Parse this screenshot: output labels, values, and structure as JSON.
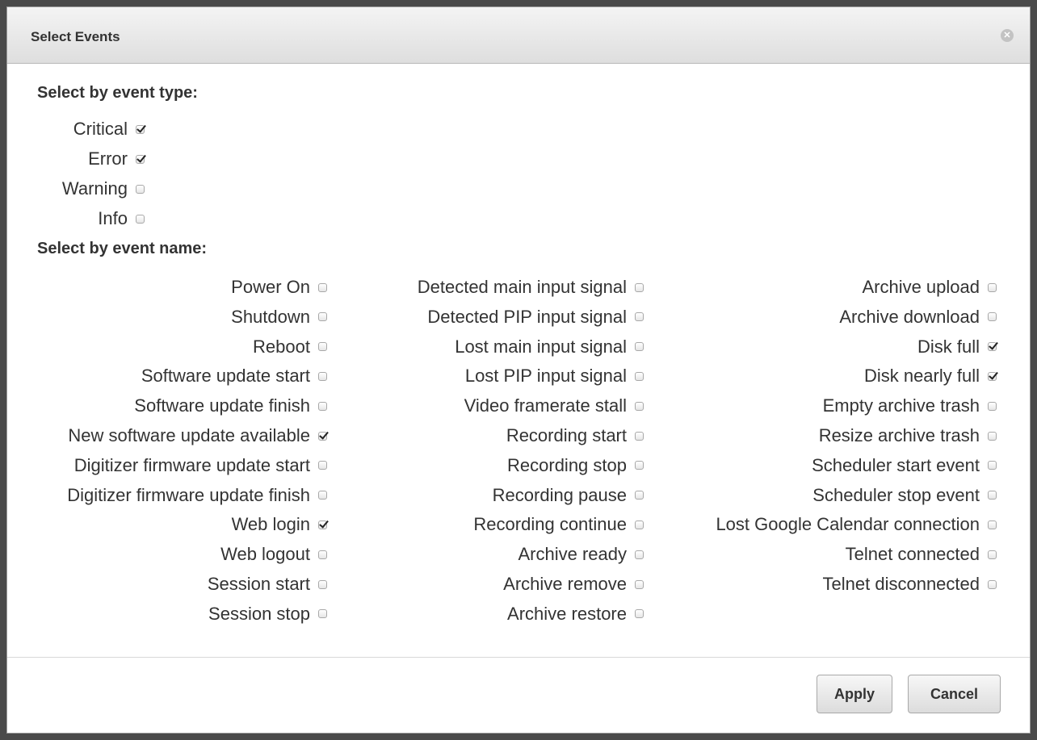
{
  "dialog": {
    "title": "Select Events",
    "close_icon": "close-circle-icon"
  },
  "type_section": {
    "heading": "Select by event type:",
    "items": [
      {
        "label": "Critical",
        "checked": true
      },
      {
        "label": "Error",
        "checked": true
      },
      {
        "label": "Warning",
        "checked": false
      },
      {
        "label": "Info",
        "checked": false
      }
    ]
  },
  "name_section": {
    "heading": "Select by event name:",
    "columns": [
      [
        {
          "label": "Power On",
          "checked": false
        },
        {
          "label": "Shutdown",
          "checked": false
        },
        {
          "label": "Reboot",
          "checked": false
        },
        {
          "label": "Software update start",
          "checked": false
        },
        {
          "label": "Software update finish",
          "checked": false
        },
        {
          "label": "New software update available",
          "checked": true
        },
        {
          "label": "Digitizer firmware update start",
          "checked": false
        },
        {
          "label": "Digitizer firmware update finish",
          "checked": false
        },
        {
          "label": "Web login",
          "checked": true
        },
        {
          "label": "Web logout",
          "checked": false
        },
        {
          "label": "Session start",
          "checked": false
        },
        {
          "label": "Session stop",
          "checked": false
        }
      ],
      [
        {
          "label": "Detected main input signal",
          "checked": false
        },
        {
          "label": "Detected PIP input signal",
          "checked": false
        },
        {
          "label": "Lost main input signal",
          "checked": false
        },
        {
          "label": "Lost PIP input signal",
          "checked": false
        },
        {
          "label": "Video framerate stall",
          "checked": false
        },
        {
          "label": "Recording start",
          "checked": false
        },
        {
          "label": "Recording stop",
          "checked": false
        },
        {
          "label": "Recording pause",
          "checked": false
        },
        {
          "label": "Recording continue",
          "checked": false
        },
        {
          "label": "Archive ready",
          "checked": false
        },
        {
          "label": "Archive remove",
          "checked": false
        },
        {
          "label": "Archive restore",
          "checked": false
        }
      ],
      [
        {
          "label": "Archive upload",
          "checked": false
        },
        {
          "label": "Archive download",
          "checked": false
        },
        {
          "label": "Disk full",
          "checked": true
        },
        {
          "label": "Disk nearly full",
          "checked": true
        },
        {
          "label": "Empty archive trash",
          "checked": false
        },
        {
          "label": "Resize archive trash",
          "checked": false
        },
        {
          "label": "Scheduler start event",
          "checked": false
        },
        {
          "label": "Scheduler stop event",
          "checked": false
        },
        {
          "label": "Lost Google Calendar connection",
          "checked": false
        },
        {
          "label": "Telnet connected",
          "checked": false
        },
        {
          "label": "Telnet disconnected",
          "checked": false
        }
      ]
    ]
  },
  "footer": {
    "apply_label": "Apply",
    "cancel_label": "Cancel"
  }
}
